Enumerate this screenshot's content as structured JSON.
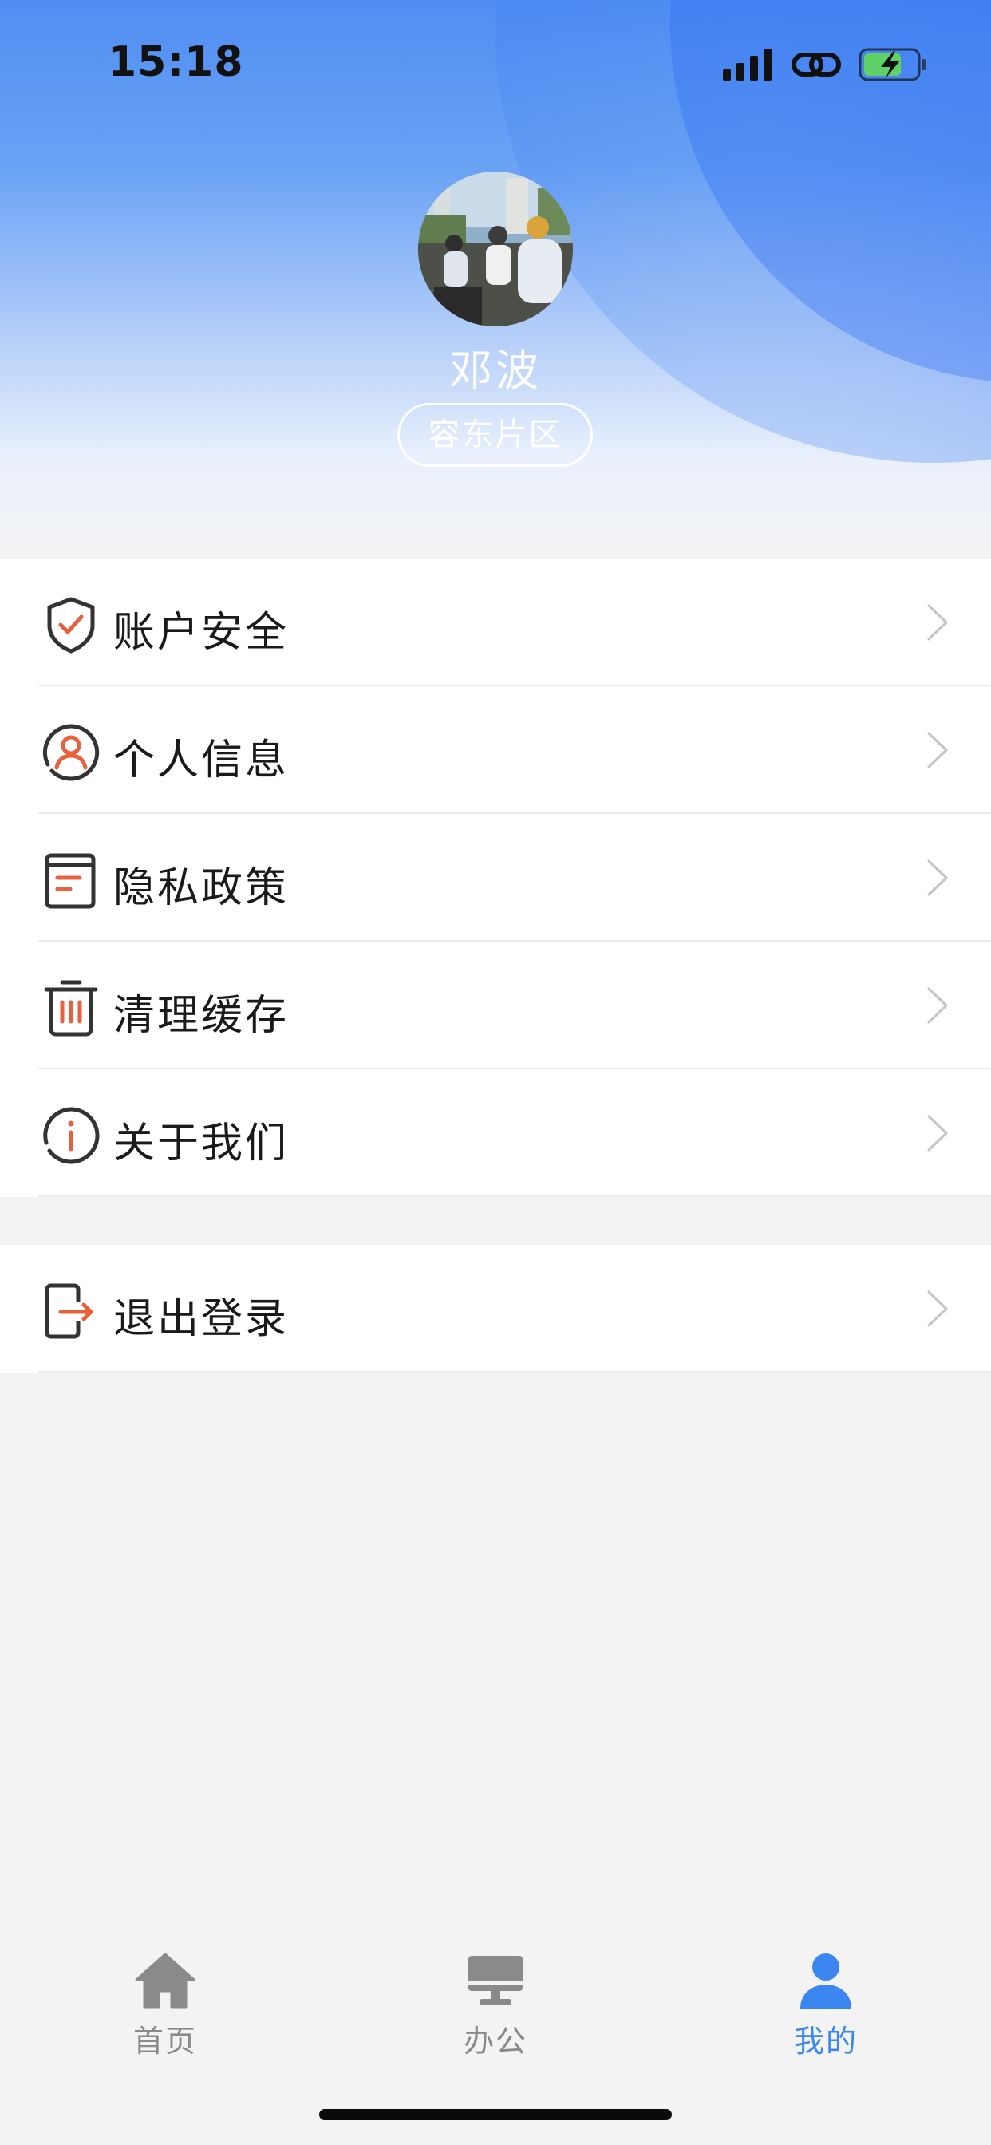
{
  "status_bar": {
    "time": "15:18",
    "icons": [
      "signal-icon",
      "link-icon",
      "battery-charging-icon"
    ]
  },
  "profile": {
    "name": "邓波",
    "region": "容东片区"
  },
  "menu": {
    "items": [
      {
        "label": "账户安全",
        "icon": "shield-check-icon"
      },
      {
        "label": "个人信息",
        "icon": "user-circle-icon"
      },
      {
        "label": "隐私政策",
        "icon": "document-icon"
      },
      {
        "label": "清理缓存",
        "icon": "trash-icon"
      },
      {
        "label": "关于我们",
        "icon": "info-circle-icon"
      }
    ],
    "logout": {
      "label": "退出登录",
      "icon": "logout-icon"
    }
  },
  "tabbar": {
    "tabs": [
      {
        "label": "首页",
        "icon": "home-icon",
        "active": false
      },
      {
        "label": "办公",
        "icon": "monitor-icon",
        "active": false
      },
      {
        "label": "我的",
        "icon": "user-icon",
        "active": true
      }
    ]
  },
  "colors": {
    "accent": "#3b86f0",
    "icon_accent": "#e8603c",
    "icon_outline": "#333333",
    "inactive_tab": "#8a8a8a"
  }
}
